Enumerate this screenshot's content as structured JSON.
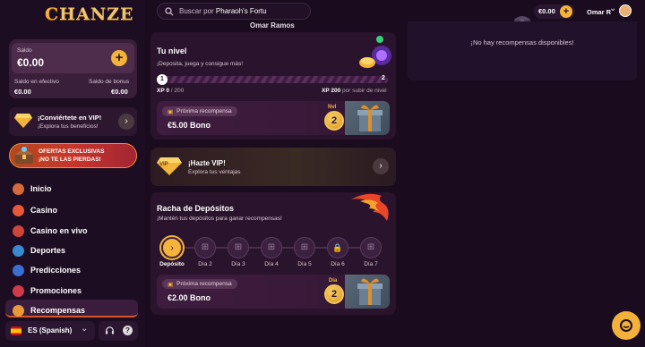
{
  "brand": {
    "logo_text": "HANZE",
    "logo_initial": "C"
  },
  "balance": {
    "label": "Saldo",
    "amount": "€0.00",
    "cash_label": "Saldo en efectivo",
    "cash_value": "€0.00",
    "bonus_label": "Saldo de bonus",
    "bonus_value": "€0.00",
    "add_symbol": "+"
  },
  "vip_promo": {
    "title": "¡Conviértete en VIP!",
    "subtitle": "¡Explora tus beneficios!"
  },
  "offers_banner": {
    "line1": "OFERTAS EXCLUSIVAS",
    "line2": "¡NO TE LAS PIERDAS!"
  },
  "nav": [
    {
      "label": "Inicio",
      "icon": "swords-icon",
      "color": "#d76a3a"
    },
    {
      "label": "Casino",
      "icon": "shield-icon",
      "color": "#e8573a"
    },
    {
      "label": "Casino en vivo",
      "icon": "dice-icon",
      "color": "#d0453a"
    },
    {
      "label": "Deportes",
      "icon": "ball-icon",
      "color": "#3a8ad0"
    },
    {
      "label": "Predicciones",
      "icon": "chart-icon",
      "color": "#3a6fd0"
    },
    {
      "label": "Promociones",
      "icon": "gem-icon",
      "color": "#d03a4a"
    },
    {
      "label": "Recompensas",
      "icon": "gift-icon",
      "color": "#e89a3a"
    }
  ],
  "language": {
    "flag": "ES",
    "label": "ES (Spanish)"
  },
  "search": {
    "placeholder": "Buscar por",
    "value": "Pharaoh's Fortu"
  },
  "center_user": "Omar Ramos",
  "level": {
    "title": "Tu nivel",
    "subtitle": "¡Deposita, juega y consigue más!",
    "current_level": "1",
    "next_level": "2",
    "progress": 0.0,
    "xp_current": "XP 0",
    "xp_total": "/ 200",
    "xp_needed_value": "XP 200",
    "xp_needed_text": "por subir de nivel",
    "reward_pill": "Próxima recompensa",
    "reward_amount": "€5.00 Bono",
    "badge_label": "Nvl",
    "badge_value": "2"
  },
  "vip_card": {
    "title": "¡Hazte VIP!",
    "subtitle": "Explora tus ventajas",
    "badge": "VIP"
  },
  "streak": {
    "title": "Racha de Depósitos",
    "subtitle": "¡Mantén tus depósitos para ganar recompensas!",
    "days": [
      "Depósito",
      "Día 2",
      "Día 3",
      "Día 4",
      "Día 5",
      "Día 6",
      "Día 7"
    ],
    "reward_pill": "Próxima recompensa",
    "reward_amount": "€2.00 Bono",
    "badge_label": "Día",
    "badge_value": "2"
  },
  "header": {
    "balance": "€0.00",
    "add_symbol": "+",
    "user_name": "Omar R"
  },
  "rewards_panel": {
    "empty_text": "¡No hay recompensas disponibles!"
  },
  "colors": {
    "accent": "#f4b43a",
    "bg": "#1a0c1e",
    "card": "#2a132c"
  }
}
